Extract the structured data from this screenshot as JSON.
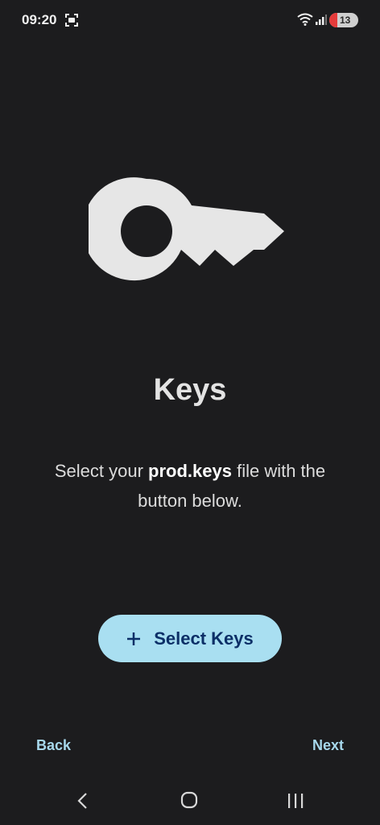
{
  "status": {
    "time": "09:20",
    "battery_level": "13"
  },
  "icons": {
    "main": "key-icon",
    "button": "plus-icon",
    "status": [
      "screenshot-icon",
      "wifi-icon",
      "signal-icon",
      "battery-icon"
    ],
    "nav": [
      "back-chevron-icon",
      "home-circle-icon",
      "recents-bars-icon"
    ]
  },
  "colors": {
    "background": "#1c1c1e",
    "key": "#e6e6e6",
    "button_bg": "#a9dff1",
    "button_text": "#0c2f67",
    "link": "#a7d8ec"
  },
  "main": {
    "title": "Keys",
    "description_before": "Select your ",
    "description_bold": "prod.keys",
    "description_after": " file with the button below.",
    "select_button_label": "Select Keys"
  },
  "footer": {
    "back_label": "Back",
    "next_label": "Next"
  }
}
